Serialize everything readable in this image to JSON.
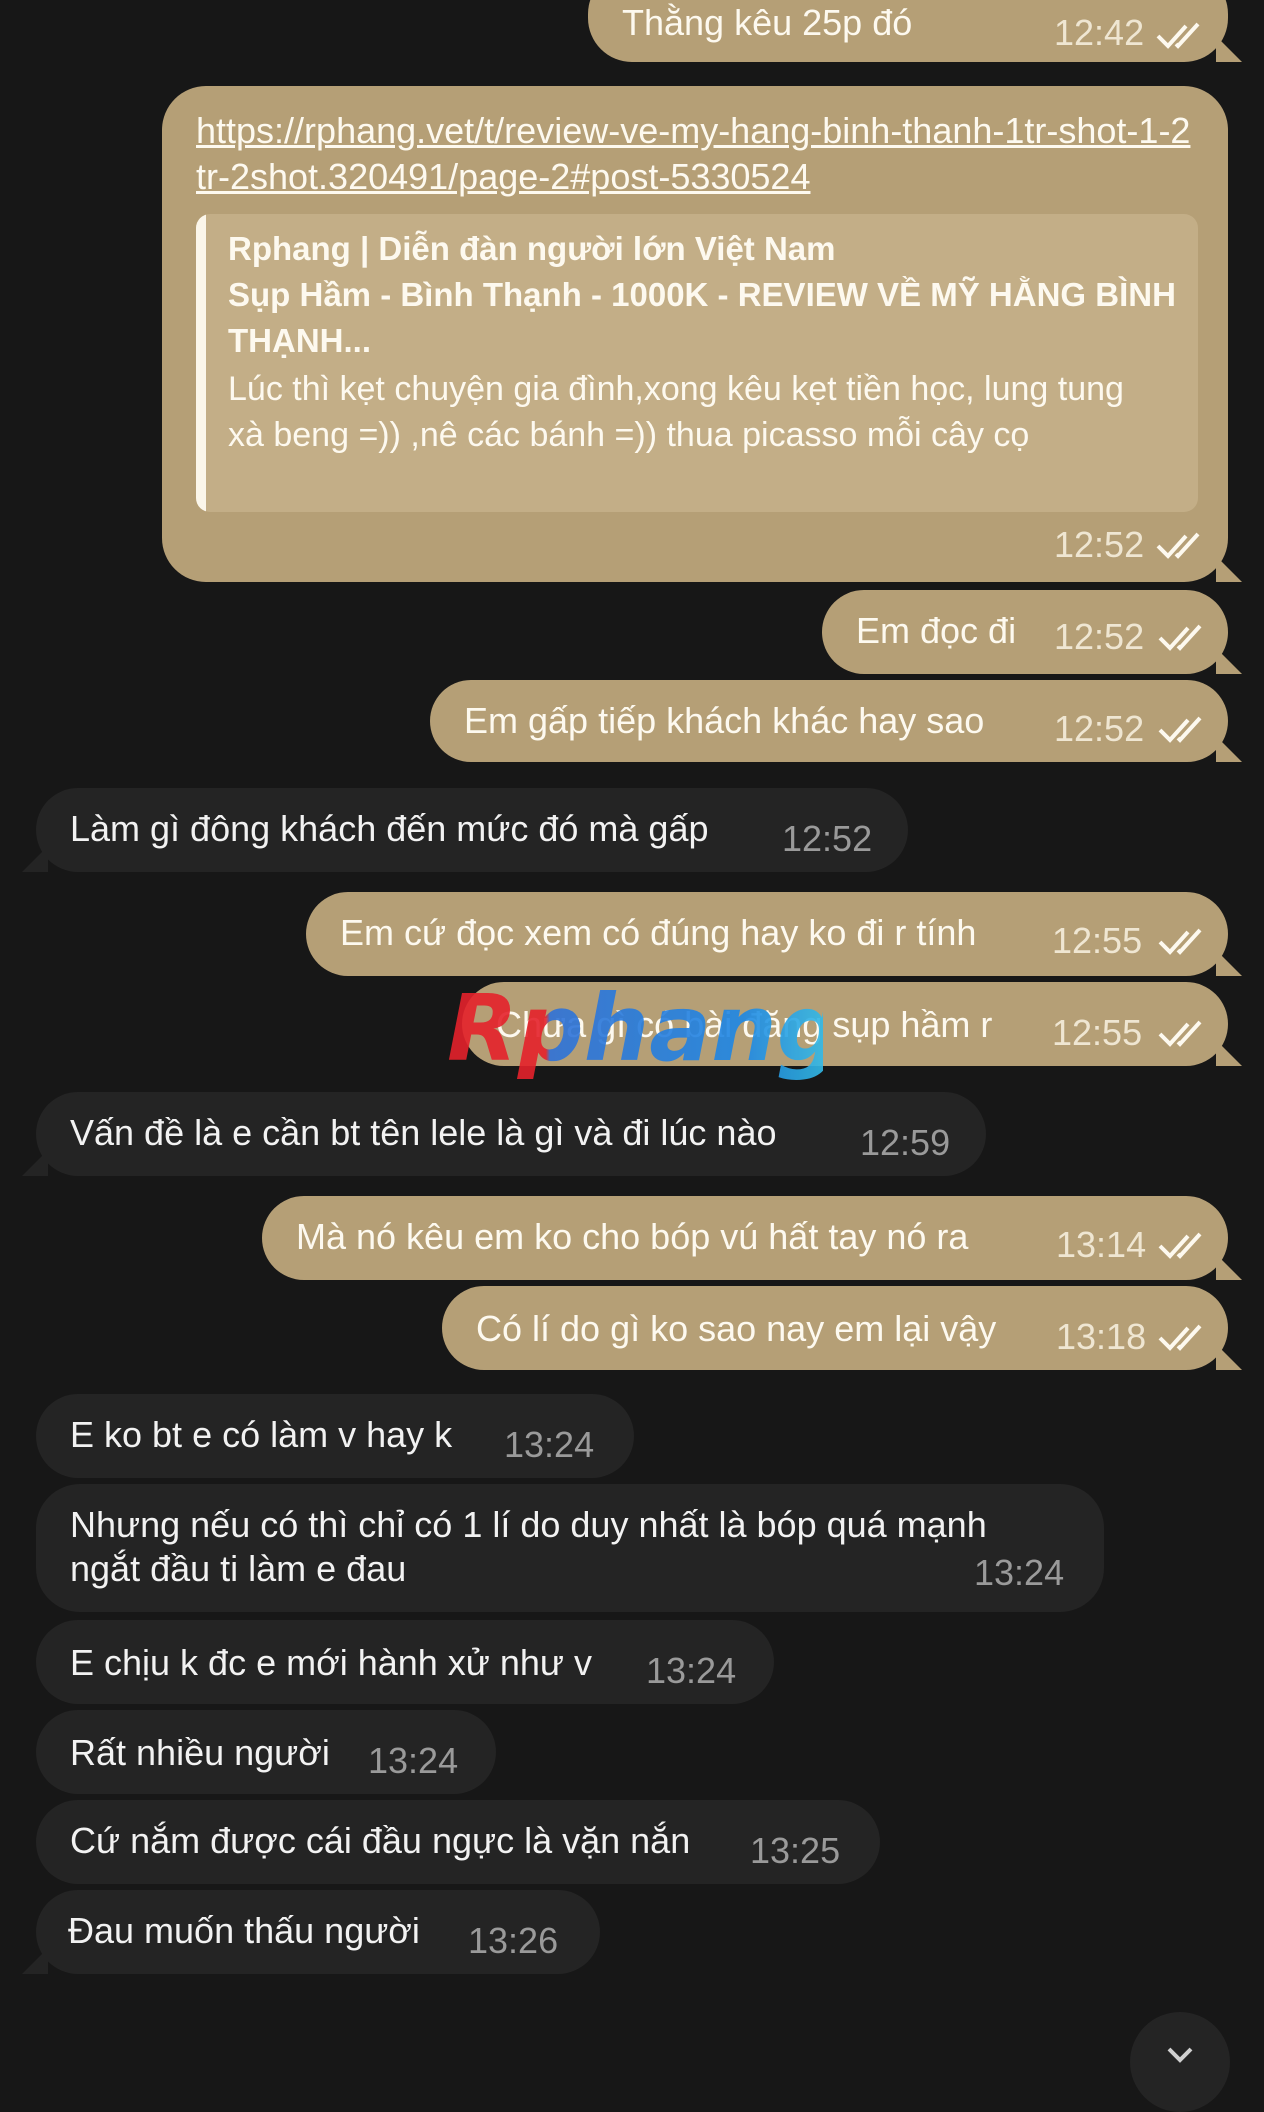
{
  "colors": {
    "background": "#171717",
    "outgoing_bubble": "#b59f76",
    "incoming_bubble": "#242424",
    "preview_box": "#c3ae87"
  },
  "messages": [
    {
      "dir": "out",
      "text": "Thằng kêu 25p đó",
      "time": "12:42",
      "read": true
    },
    {
      "dir": "out",
      "type": "link",
      "link": "https://rphang.vet/t/review-ve-my-hang-binh-thanh-1tr-shot-1-2tr-2shot.320491/page-2#post-5330524",
      "preview": {
        "site": "Rphang | Diễn đàn người lớn Việt Nam",
        "title": "Sụp Hầm - Bình Thạnh - 1000K - REVIEW VỀ MỸ HẰNG BÌNH THẠNH...",
        "description": "Lúc thì kẹt chuyện gia đình,xong kêu kẹt tiền học, lung tung xà beng =)) ,nê các bánh =)) thua picasso mỗi cây cọ"
      },
      "time": "12:52",
      "read": true
    },
    {
      "dir": "out",
      "text": "Em đọc đi",
      "time": "12:52",
      "read": true
    },
    {
      "dir": "out",
      "text": "Em gấp tiếp khách khác hay sao",
      "time": "12:52",
      "read": true
    },
    {
      "dir": "in",
      "text": "Làm gì đông khách đến mức đó mà gấp",
      "time": "12:52"
    },
    {
      "dir": "out",
      "text": "Em cứ đọc xem có đúng hay ko đi r tính",
      "time": "12:55",
      "read": true
    },
    {
      "dir": "out",
      "text": "Chưa gì có bài đăng sụp hầm r",
      "time": "12:55",
      "read": true
    },
    {
      "dir": "in",
      "text": "Vấn đề là e cần bt tên lele là gì và đi lúc nào",
      "time": "12:59"
    },
    {
      "dir": "out",
      "text": "Mà nó kêu em ko cho bóp vú hất tay nó ra",
      "time": "13:14",
      "read": true
    },
    {
      "dir": "out",
      "text": "Có lí do gì ko sao nay em lại vậy",
      "time": "13:18",
      "read": true
    },
    {
      "dir": "in",
      "text": "E ko bt e có làm v hay k",
      "time": "13:24"
    },
    {
      "dir": "in",
      "text_line1": "Nhưng nếu có thì chỉ có 1 lí do duy nhất là bóp quá mạnh",
      "text_line2": "ngắt đầu ti làm e đau",
      "time": "13:24"
    },
    {
      "dir": "in",
      "text": "E chịu k đc e mới hành xử như v",
      "time": "13:24"
    },
    {
      "dir": "in",
      "text": "Rất nhiều người",
      "time": "13:24"
    },
    {
      "dir": "in",
      "text": "Cứ nắm được cái đầu ngực là vặn nắn",
      "time": "13:25"
    },
    {
      "dir": "in",
      "text": "Đau muốn thấu người",
      "time": "13:26"
    }
  ],
  "watermark": {
    "text": "Rphang"
  },
  "icons": {
    "read_receipt": "double-check-icon",
    "scroll_down": "chevron-down-icon"
  }
}
